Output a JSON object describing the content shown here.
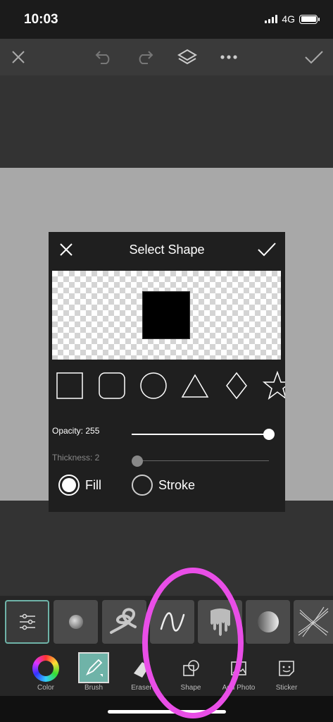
{
  "status_bar": {
    "time": "10:03",
    "network": "4G"
  },
  "dialog": {
    "title": "Select Shape",
    "opacity_label": "Opacity: 255",
    "opacity_value": 255,
    "thickness_label": "Thickness: 2",
    "thickness_value": 2,
    "fill_label": "Fill",
    "stroke_label": "Stroke",
    "selected_mode": "Fill",
    "shape_options": [
      "square-icon",
      "rounded-square-icon",
      "circle-icon",
      "triangle-icon",
      "diamond-icon",
      "star-icon"
    ],
    "selected_shape": "square"
  },
  "tools": {
    "color": "Color",
    "brush": "Brush",
    "eraser": "Eraser",
    "shape": "Shape",
    "add_photo": "Add Photo",
    "sticker": "Sticker"
  },
  "colors": {
    "highlight": "#e94ee7",
    "canvas": "#a8a8a8",
    "dialog": "#1f1f1f",
    "selected_accent": "#6fb3a8"
  }
}
